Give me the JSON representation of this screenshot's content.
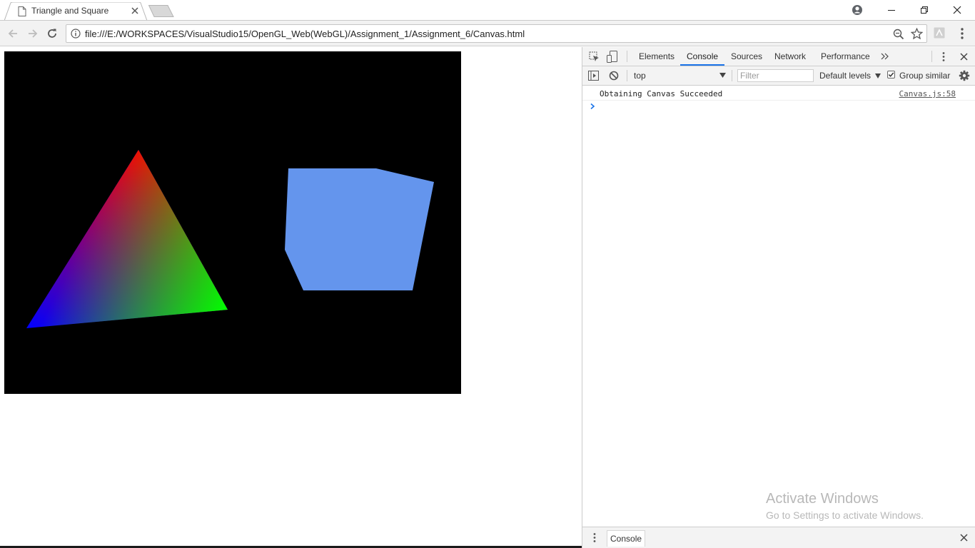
{
  "browser": {
    "tab": {
      "title": "Triangle and Square"
    },
    "address_bar": {
      "url": "file:///E:/WORKSPACES/VisualStudio15/OpenGL_Web(WebGL)/Assignment_1/Assignment_6/Canvas.html"
    }
  },
  "page": {
    "canvas": {
      "background": "#000000",
      "triangle_vertex_colors": [
        "#ff0000",
        "#0000ff",
        "#00ff00"
      ],
      "square_color": "#6495ed"
    }
  },
  "devtools": {
    "tabs": [
      "Elements",
      "Console",
      "Sources",
      "Network",
      "Performance"
    ],
    "active_tab": "Console",
    "console_toolbar": {
      "context": "top",
      "filter_placeholder": "Filter",
      "levels": "Default levels",
      "group_similar_label": "Group similar",
      "group_similar_checked": true
    },
    "messages": [
      {
        "text": "Obtaining Canvas Succeeded",
        "source": "Canvas.js:58"
      }
    ],
    "drawer": {
      "tab": "Console"
    }
  },
  "watermark": {
    "title": "Activate Windows",
    "subtitle": "Go to Settings to activate Windows."
  }
}
